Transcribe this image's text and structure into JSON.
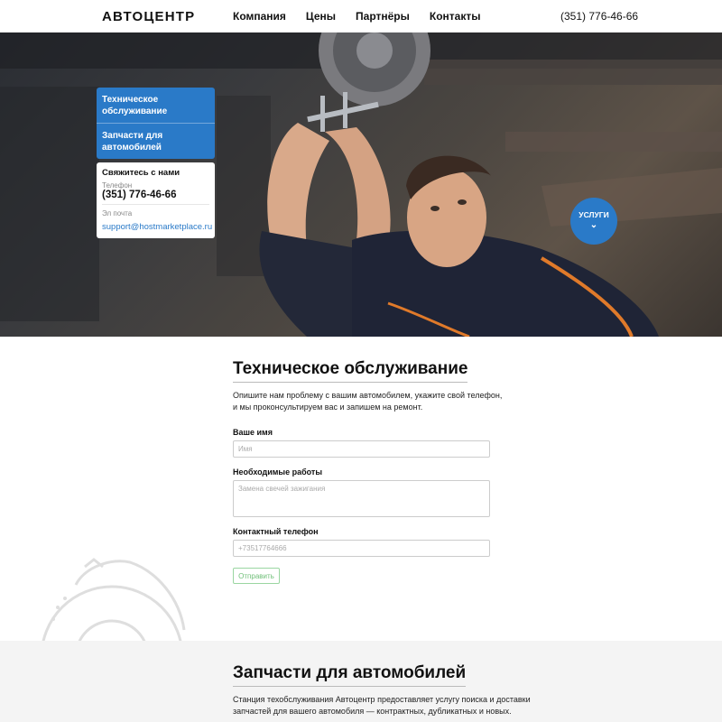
{
  "header": {
    "logo": "АВТОЦЕНТР",
    "nav": [
      "Компания",
      "Цены",
      "Партнёры",
      "Контакты"
    ],
    "phone": "(351) 776-46-66"
  },
  "hero": {
    "menu": [
      "Техническое обслуживание",
      "Запчасти для автомобилей"
    ],
    "contact": {
      "title": "Свяжитесь с нами",
      "phone_label": "Телефон",
      "phone": "(351) 776-46-66",
      "email_label": "Эл почта",
      "email": "support@hostmarketplace.ru"
    },
    "services_button": "УСЛУГИ",
    "chevron_icon": "chevron-down-icon",
    "accent_color": "#2a7ac8"
  },
  "form_section": {
    "title": "Техническое обслуживание",
    "desc_line1": "Опишите нам проблему с вашим автомобилем, укажите свой телефон,",
    "desc_line2": "и мы проконсультируем вас и запишем на ремонт.",
    "name_label": "Ваше имя",
    "name_placeholder": "Имя",
    "works_label": "Необходимые работы",
    "works_placeholder": "Замена свечей зажигания",
    "phone_label": "Контактный телефон",
    "phone_placeholder": "+73517764666",
    "submit_label": "Отправить",
    "submit_color": "#6fbf78"
  },
  "parts_section": {
    "title": "Запчасти для автомобилей",
    "desc_line1": "Станция техобслуживания Автоцентр предоставляет услугу поиска и доставки",
    "desc_line2": "запчастей для вашего автомобиля — контрактных, дубликатных и новых."
  }
}
